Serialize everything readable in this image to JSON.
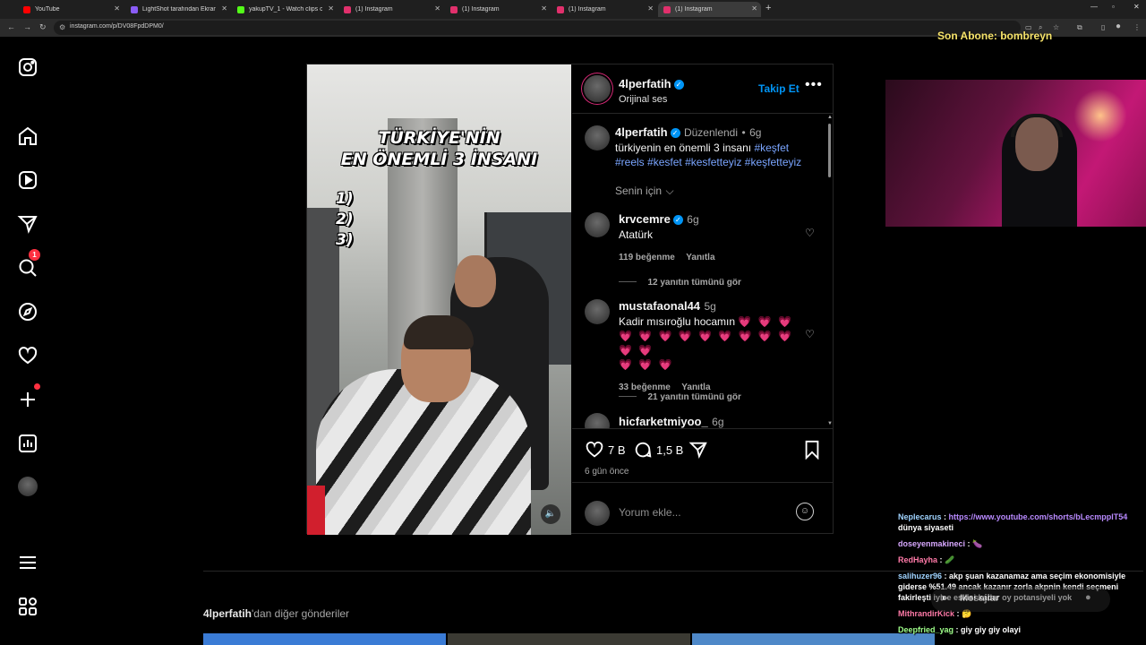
{
  "browser": {
    "tabs": [
      {
        "label": "YouTube",
        "color": "#ff0000",
        "active": false
      },
      {
        "label": "LightShot tarafından Ekran Görü",
        "color": "#8a5cf6",
        "active": false
      },
      {
        "label": "yakupTV_1 - Watch clips on Ki",
        "color": "#53fc18",
        "active": false
      },
      {
        "label": "(1) Instagram",
        "color": "#e1306c",
        "active": false
      },
      {
        "label": "(1) Instagram",
        "color": "#e1306c",
        "active": false
      },
      {
        "label": "(1) Instagram",
        "color": "#e1306c",
        "active": false
      },
      {
        "label": "(1) Instagram",
        "color": "#e1306c",
        "active": true
      }
    ],
    "url": "instagram.com/p/DV08FpdDPM0/"
  },
  "overlay": {
    "subscriber": "Son Abone: bombreyn"
  },
  "nav": {
    "badge_count": "1",
    "icons": [
      "instagram-logo-icon",
      "home-icon",
      "reels-icon",
      "messages-icon",
      "search-icon",
      "explore-icon",
      "notifications-icon",
      "create-icon",
      "dashboard-icon",
      "profile-avatar",
      "menu-icon",
      "more-apps-icon"
    ]
  },
  "post": {
    "video": {
      "title_line1": "TÜRKİYE'NİN",
      "title_line2": "EN ÖNEMLİ 3 İNSANI",
      "list": [
        "1)",
        "2)",
        "3)"
      ]
    },
    "author": {
      "username": "4lperfatih",
      "audio": "Orijinal ses",
      "follow": "Takip Et"
    },
    "caption": {
      "username": "4lperfatih",
      "edited": "Düzenlendi",
      "sep": "•",
      "time": "6g",
      "text": "türkiyenin en önemli 3 insanı",
      "tags": [
        "#keşfet",
        "#reels",
        "#kesfet",
        "#kesfetteyiz",
        "#keşfetteyiz"
      ],
      "for_you": "Senin için"
    },
    "comments": [
      {
        "username": "krvcemre",
        "verified": true,
        "time": "6g",
        "text": "Atatürk",
        "likes": "119 beğenme",
        "reply": "Yanıtla",
        "view_replies": "12 yanıtın tümünü gör"
      },
      {
        "username": "mustafaonal44",
        "verified": false,
        "time": "5g",
        "text": "Kadir mısıroğlu hocamın",
        "hearts_line1": "💗 💗 💗",
        "hearts_line2": "💗 💗 💗 💗 💗 💗 💗 💗 💗 💗 💗",
        "hearts_line3": "💗 💗 💗",
        "likes": "33 beğenme",
        "reply": "Yanıtla",
        "view_replies": "21 yanıtın tümünü gör"
      },
      {
        "username": "hicfarketmiyoo_",
        "verified": false,
        "time": "6g"
      }
    ],
    "stats": {
      "likes": "7 B",
      "comments": "1,5 B",
      "posted": "6 gün önce"
    },
    "add_comment_placeholder": "Yorum ekle..."
  },
  "more_posts": {
    "username": "4lperfatih",
    "suffix": "'dan diğer gönderiler"
  },
  "chat": [
    {
      "user": "Neplecarus",
      "text": "https://www.youtube.com/shorts/bLecmppIT54",
      "text2": "dünya siyaseti"
    },
    {
      "user": "doseyenmakineci",
      "text": "🍆"
    },
    {
      "user": "RedHayha",
      "text": "🥒"
    },
    {
      "user": "salihuzer96",
      "text": "akp şuan kazanamaz ama seçim ekonomisiyle giderse %51.49 ancak kazanır zorla akpnin kendi seçmeni fakirleşti iyice eskisi kadar oy potansiyeli yok"
    },
    {
      "user": "MithrandirKick",
      "text": "🤔"
    },
    {
      "user": "Deepfried_yag",
      "text": "giy giy giy olayi"
    }
  ],
  "messages_label": "Mesajlar",
  "colors": {
    "accent": "#0095f6",
    "badge": "#ff3040"
  }
}
